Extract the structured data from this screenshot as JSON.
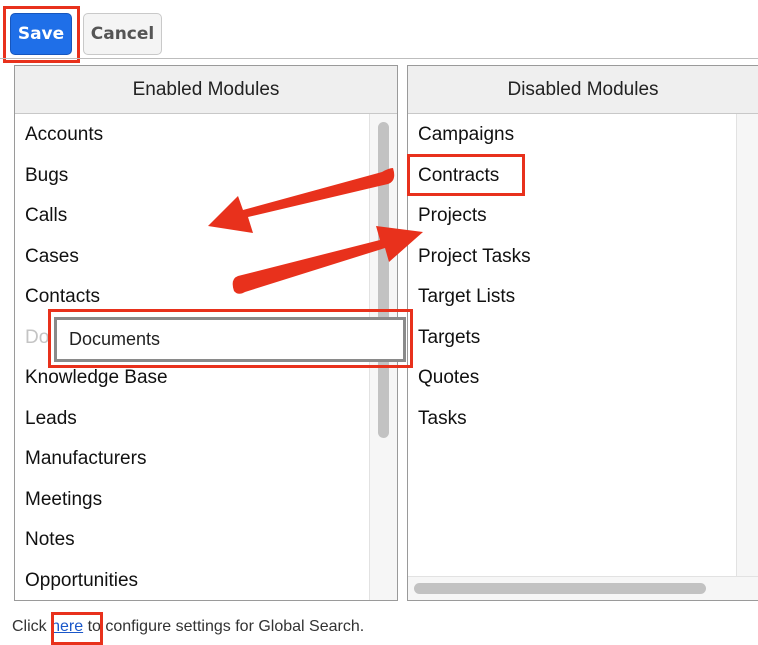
{
  "toolbar": {
    "save_label": "Save",
    "cancel_label": "Cancel"
  },
  "enabled": {
    "title": "Enabled Modules",
    "items": [
      "Accounts",
      "Bugs",
      "Calls",
      "Cases",
      "Contacts",
      "Do",
      "Knowledge Base",
      "Leads",
      "Manufacturers",
      "Meetings",
      "Notes",
      "Opportunities"
    ]
  },
  "disabled": {
    "title": "Disabled Modules",
    "items": [
      "Campaigns",
      "Contracts",
      "Projects",
      "Project Tasks",
      "Target Lists",
      "Targets",
      "Quotes",
      "Tasks"
    ]
  },
  "dragging": {
    "label": "Documents"
  },
  "footer": {
    "before": "Click ",
    "link": "here",
    "after": " to configure settings for Global Search."
  },
  "colors": {
    "highlight": "#e8311c",
    "primary": "#1f6fe8",
    "arrow": "#e8311c"
  }
}
